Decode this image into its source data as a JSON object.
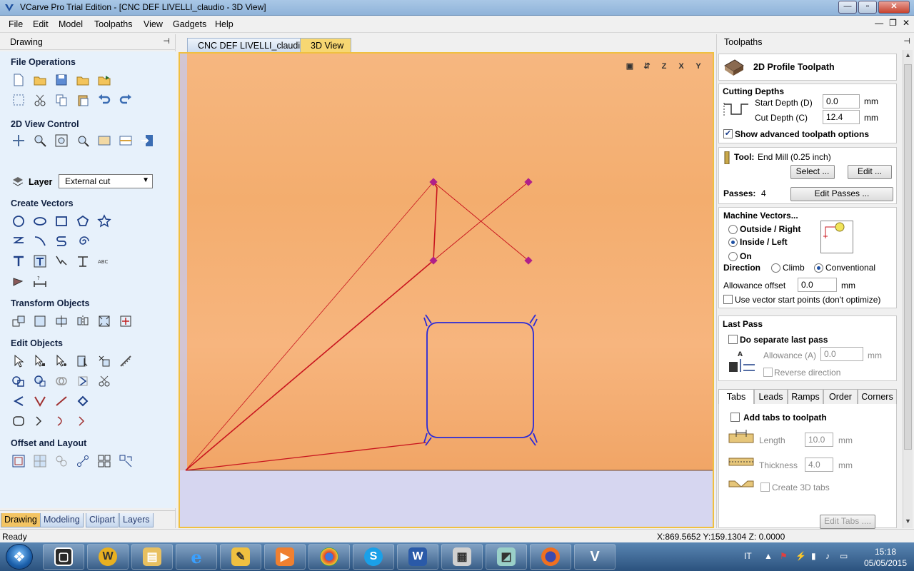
{
  "window": {
    "title": "VCarve Pro Trial Edition - [CNC DEF LIVELLI_claudio - 3D View]",
    "minimize": "—",
    "maximize": "▫",
    "close": "✕"
  },
  "menu": [
    "File",
    "Edit",
    "Model",
    "Toolpaths",
    "View",
    "Gadgets",
    "Help"
  ],
  "mdi_controls": {
    "minimize": "—",
    "restore": "❐",
    "close": "✕"
  },
  "left_panel": {
    "title": "Drawing",
    "pin": "⊣",
    "sections": {
      "file_operations": "File Operations",
      "view_control": "2D View Control",
      "create_vectors": "Create Vectors",
      "transform_objects": "Transform Objects",
      "edit_objects": "Edit Objects",
      "offset_layout": "Offset and Layout"
    },
    "layer_label": "Layer",
    "layer_value": "External cut",
    "tabs": [
      "Drawing",
      "Modeling",
      "Clipart",
      "Layers"
    ],
    "active_tab": "Drawing"
  },
  "doc_tabs": [
    "CNC DEF LIVELLI_claudio",
    "3D View"
  ],
  "active_doc_tab": "3D View",
  "view_tools": [
    "▣",
    "⇵",
    "Z",
    "X",
    "Y"
  ],
  "toolpaths_panel": {
    "title": "Toolpaths",
    "pin": "⊣",
    "toolpath_name": "2D Profile Toolpath",
    "cutting_depths": {
      "title": "Cutting Depths",
      "start_label": "Start Depth (D)",
      "start_value": "0.0",
      "cut_label": "Cut Depth (C)",
      "cut_value": "12.4",
      "unit": "mm",
      "show_advanced": "Show advanced toolpath options",
      "show_advanced_checked": true
    },
    "tool": {
      "label": "Tool:",
      "name": "End Mill (0.25 inch)",
      "select_button": "Select ...",
      "edit_button": "Edit ...",
      "passes_label": "Passes:",
      "passes_value": "4",
      "edit_passes_button": "Edit Passes ..."
    },
    "machine_vectors": {
      "title": "Machine Vectors...",
      "options": [
        "Outside / Right",
        "Inside / Left",
        "On"
      ],
      "selected": "Inside / Left",
      "direction_label": "Direction",
      "direction_options": [
        "Climb",
        "Conventional"
      ],
      "direction_selected": "Conventional",
      "allowance_label": "Allowance offset",
      "allowance_value": "0.0",
      "unit": "mm",
      "use_start_points": "Use vector start points (don't optimize)",
      "use_start_points_checked": false
    },
    "last_pass": {
      "title": "Last Pass",
      "do_separate": "Do separate last pass",
      "do_separate_checked": false,
      "allowance_label": "Allowance (A)",
      "allowance_value": "0.0",
      "unit": "mm",
      "reverse": "Reverse direction"
    },
    "subtabs": [
      "Tabs",
      "Leads",
      "Ramps",
      "Order",
      "Corners"
    ],
    "active_subtab": "Tabs",
    "tabs_section": {
      "add_tabs": "Add tabs to toolpath",
      "add_tabs_checked": false,
      "length_label": "Length",
      "length_value": "10.0",
      "thickness_label": "Thickness",
      "thickness_value": "4.0",
      "unit": "mm",
      "create_3d": "Create 3D tabs",
      "edit_tabs_button": "Edit Tabs ...."
    }
  },
  "status": {
    "left": "Ready",
    "coords": "X:869.5652 Y:159.1304 Z: 0.0000"
  },
  "taskbar": {
    "language": "IT",
    "time": "15:18",
    "date": "05/05/2015"
  },
  "colors": {
    "wood": "#f2a96a",
    "toolpath_red": "#c8141e",
    "toolpath_blue": "#2a2ad8",
    "tab_active": "#f3c463"
  }
}
